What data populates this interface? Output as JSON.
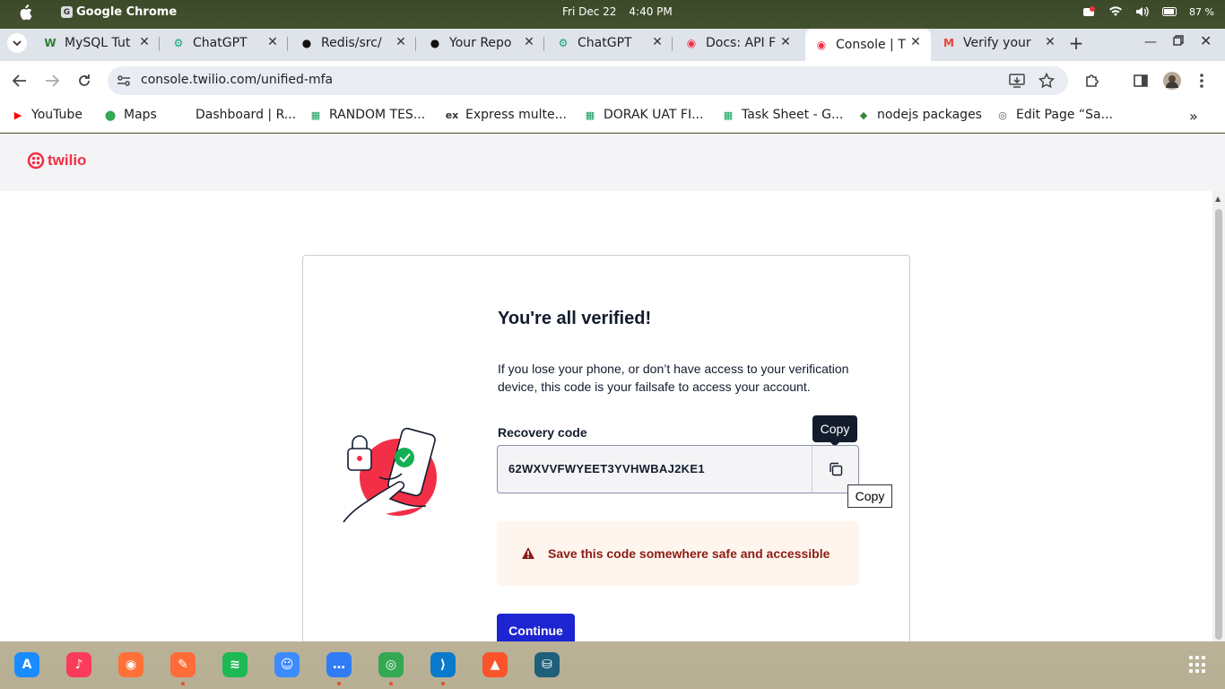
{
  "system_bar": {
    "app_name": "Google Chrome",
    "date": "Fri Dec 22",
    "time": "4:40 PM",
    "battery": "87 %"
  },
  "tabs": [
    {
      "label": "MySQL Tut",
      "icon": "w-icon",
      "icon_color": "#2e7d32"
    },
    {
      "label": "ChatGPT",
      "icon": "chatgpt-icon",
      "icon_color": "#10a37f"
    },
    {
      "label": "Redis/src/",
      "icon": "github-icon",
      "icon_color": "#111111"
    },
    {
      "label": "Your Repo",
      "icon": "github-icon",
      "icon_color": "#111111"
    },
    {
      "label": "ChatGPT",
      "icon": "chatgpt-icon",
      "icon_color": "#10a37f"
    },
    {
      "label": "Docs: API F",
      "icon": "twilio-icon",
      "icon_color": "#f22f46"
    },
    {
      "label": "Console | T",
      "icon": "twilio-icon",
      "icon_color": "#f22f46",
      "active": true
    },
    {
      "label": "Verify your",
      "icon": "gmail-icon",
      "icon_color": "#ea4335"
    }
  ],
  "address_bar": {
    "url": "console.twilio.com/unified-mfa"
  },
  "bookmarks": [
    {
      "label": "YouTube",
      "icon": "youtube-icon"
    },
    {
      "label": "Maps",
      "icon": "maps-icon"
    },
    {
      "label": "Dashboard | R...",
      "icon": "blank-icon"
    },
    {
      "label": "RANDOM TES...",
      "icon": "sheets-icon"
    },
    {
      "label": "Express multe...",
      "icon": "ex-icon"
    },
    {
      "label": "DORAK UAT FI...",
      "icon": "sheets-icon"
    },
    {
      "label": "Task Sheet - G...",
      "icon": "sheets-icon"
    },
    {
      "label": "nodejs packages",
      "icon": "nodejs-icon"
    },
    {
      "label": "Edit Page “Sa...",
      "icon": "wordpress-icon"
    }
  ],
  "twilio": {
    "logo_text": "twilio",
    "brand_color": "#f22f46"
  },
  "mfa": {
    "title": "You're all verified!",
    "description": "If you lose your phone, or don’t have access to your verification device, this code is your failsafe to access your account.",
    "recovery_label": "Recovery code",
    "recovery_code": "62WXVVFWYEET3YVHWBAJ2KE1",
    "copy_tooltip": "Copy",
    "copy_native_tooltip": "Copy",
    "warning": "Save this code somewhere safe and accessible",
    "continue_label": "Continue",
    "button_color": "#1d24d1"
  },
  "dock": [
    {
      "name": "app-store",
      "color": "#1a8cff"
    },
    {
      "name": "music",
      "color": "#fa3c5a"
    },
    {
      "name": "firefox",
      "color": "#ff7139"
    },
    {
      "name": "postman",
      "color": "#ff6c37"
    },
    {
      "name": "spotify",
      "color": "#1db954"
    },
    {
      "name": "finder",
      "color": "#3d8bfd"
    },
    {
      "name": "messages",
      "color": "#2f7cf6"
    },
    {
      "name": "chrome",
      "color": "#34a853"
    },
    {
      "name": "vscode",
      "color": "#0a7acc"
    },
    {
      "name": "brave",
      "color": "#fb542b"
    },
    {
      "name": "mysql-workbench",
      "color": "#1f5f7a"
    }
  ]
}
